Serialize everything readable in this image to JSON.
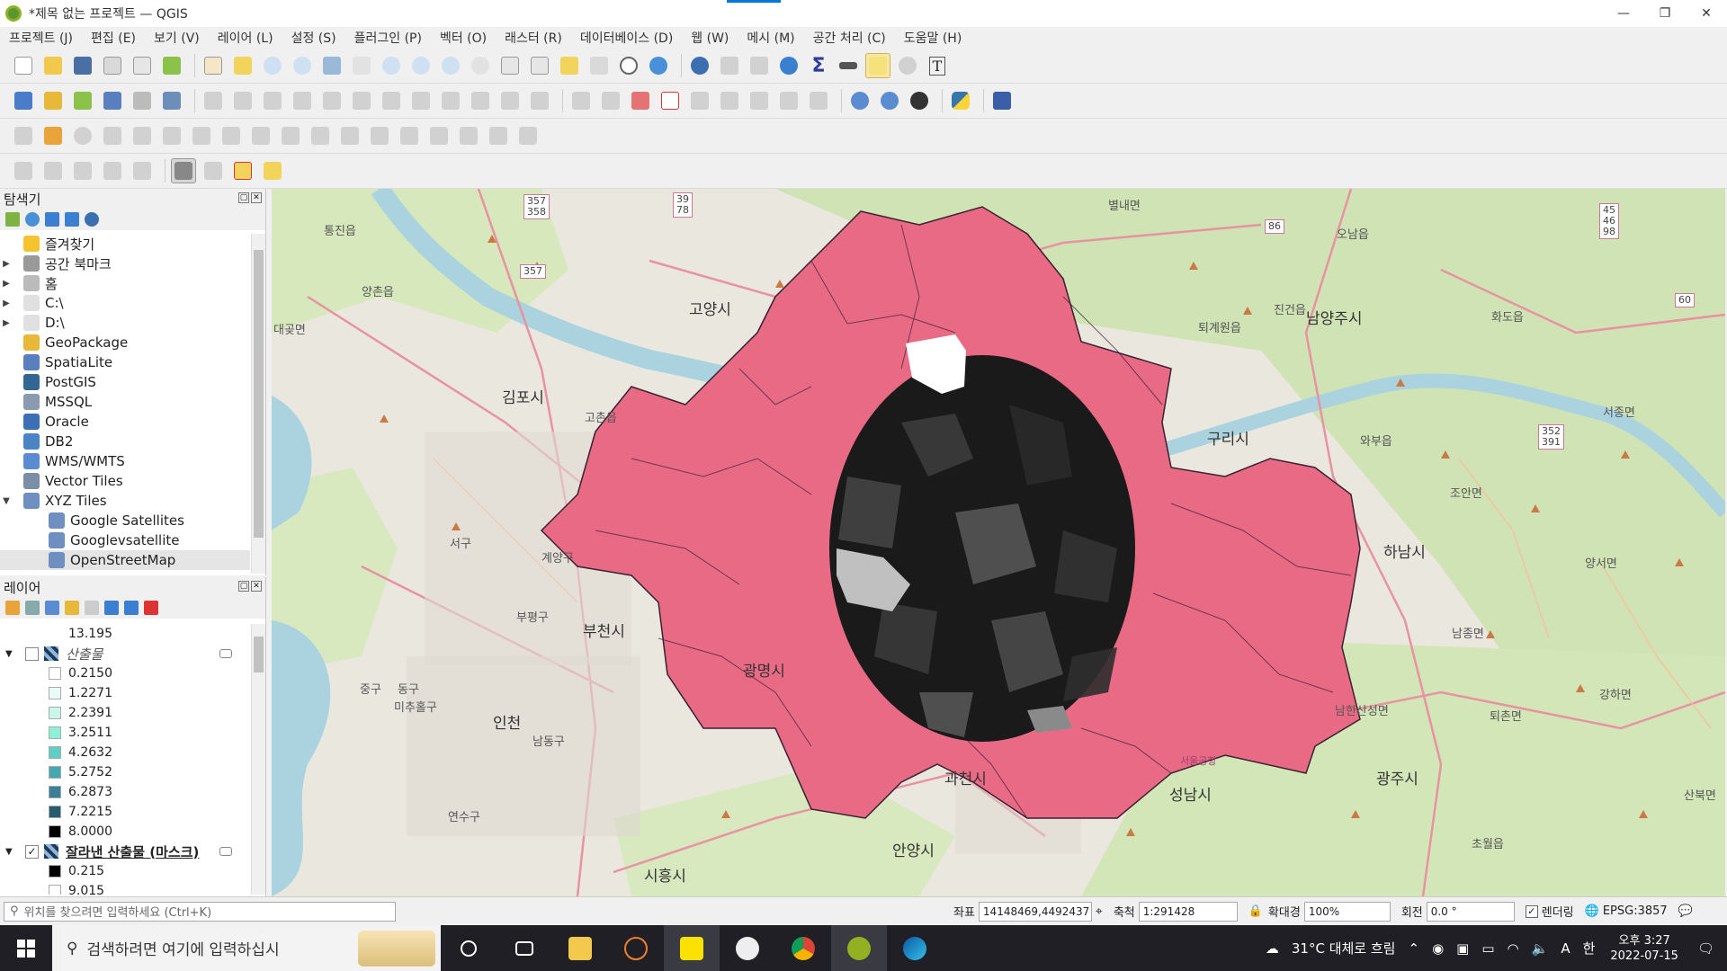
{
  "window": {
    "title": "*제목 없는 프로젝트 — QGIS",
    "minimize": "—",
    "restore": "❐",
    "close": "✕"
  },
  "menu": [
    "프로젝트 (J)",
    "편집 (E)",
    "보기 (V)",
    "레이어 (L)",
    "설정 (S)",
    "플러그인 (P)",
    "벡터 (O)",
    "래스터 (R)",
    "데이터베이스 (D)",
    "웹 (W)",
    "메시 (M)",
    "공간 처리 (C)",
    "도움말 (H)"
  ],
  "browser": {
    "title": "탐색기",
    "items": [
      {
        "label": "즐겨찾기",
        "icon": "star-icon",
        "arrow": "",
        "color": "#f4c430"
      },
      {
        "label": "공간 북마크",
        "icon": "bookmark-icon",
        "arrow": "▶",
        "color": "#999999"
      },
      {
        "label": "홈",
        "icon": "home-icon",
        "arrow": "▶",
        "color": "#bbbbbb"
      },
      {
        "label": "C:\\",
        "icon": "folder-icon",
        "arrow": "▶",
        "color": "#e0e0e0"
      },
      {
        "label": "D:\\",
        "icon": "folder-icon",
        "arrow": "▶",
        "color": "#e0e0e0"
      },
      {
        "label": "GeoPackage",
        "icon": "geopackage-icon",
        "arrow": "",
        "color": "#e8b83a"
      },
      {
        "label": "SpatiaLite",
        "icon": "spatialite-icon",
        "arrow": "",
        "color": "#5a7fbf"
      },
      {
        "label": "PostGIS",
        "icon": "postgis-icon",
        "arrow": "",
        "color": "#336791"
      },
      {
        "label": "MSSQL",
        "icon": "mssql-icon",
        "arrow": "",
        "color": "#8a9bb0"
      },
      {
        "label": "Oracle",
        "icon": "oracle-icon",
        "arrow": "",
        "color": "#3d6fb5"
      },
      {
        "label": "DB2",
        "icon": "db2-icon",
        "arrow": "",
        "color": "#4a84c4"
      },
      {
        "label": "WMS/WMTS",
        "icon": "globe-icon",
        "arrow": "",
        "color": "#5b8bd0"
      },
      {
        "label": "Vector Tiles",
        "icon": "grid-icon",
        "arrow": "",
        "color": "#7a8ea8"
      },
      {
        "label": "XYZ Tiles",
        "icon": "grid-icon",
        "arrow": "▼",
        "color": "#6f8fc0"
      },
      {
        "label": "Google Satellites",
        "icon": "grid-icon",
        "arrow": "",
        "sub": true,
        "color": "#6f8fc0"
      },
      {
        "label": "Googlevsatellite",
        "icon": "grid-icon",
        "arrow": "",
        "sub": true,
        "color": "#6f8fc0"
      },
      {
        "label": "OpenStreetMap",
        "icon": "grid-icon",
        "arrow": "",
        "sub": true,
        "selected": true,
        "color": "#6f8fc0"
      }
    ]
  },
  "layers": {
    "title": "레이어",
    "top_value": "13.195",
    "group1": {
      "name": "산출물",
      "checked": false,
      "entries": [
        {
          "label": "0.2150",
          "color": "#ffffff"
        },
        {
          "label": "1.2271",
          "color": "#e8fbf6"
        },
        {
          "label": "2.2391",
          "color": "#c8f7ea"
        },
        {
          "label": "3.2511",
          "color": "#8ef0d6"
        },
        {
          "label": "4.2632",
          "color": "#5fcfc4"
        },
        {
          "label": "5.2752",
          "color": "#45a8b0"
        },
        {
          "label": "6.2873",
          "color": "#3a7f97"
        },
        {
          "label": "7.2215",
          "color": "#285a6e"
        },
        {
          "label": "8.0000",
          "color": "#000000"
        }
      ]
    },
    "group2": {
      "name": "잘라낸 산출물 (마스크)",
      "checked": true,
      "entries": [
        {
          "label": "0.215",
          "color": "#000000"
        },
        {
          "label": "9.015",
          "color": "#ffffff"
        }
      ]
    }
  },
  "map": {
    "labels": {
      "cities": [
        "고양시",
        "김포시",
        "부천시",
        "인천",
        "남양주시",
        "구리시",
        "하남시",
        "성남시",
        "과천시",
        "안양시",
        "광명시",
        "시흥시",
        "광주시"
      ],
      "towns": [
        "통진읍",
        "양촌읍",
        "대곶면",
        "고촌읍",
        "서구",
        "계양구",
        "부평구",
        "중구",
        "동구",
        "미추홀구",
        "남동구",
        "연수구",
        "진건읍",
        "오남읍",
        "화도읍",
        "별내면",
        "퇴계원읍",
        "와부읍",
        "조안면",
        "서종면",
        "양서면",
        "남종면",
        "퇴촌면",
        "강하면",
        "남한산성면",
        "초월읍",
        "산북면",
        "서울공항"
      ],
      "shields": [
        "357\n358",
        "357",
        "39\n78",
        "86",
        "60",
        "45\n46\n98",
        "352\n391"
      ]
    },
    "colors": {
      "mask_fill": "#e86a85",
      "base": "#eae7df",
      "green": "#cfe3b4",
      "water": "#aad3df"
    }
  },
  "status": {
    "locator_placeholder": "위치를 찾으려면 입력하세요 (Ctrl+K)",
    "coord_label": "좌표",
    "coord_value": "14148469,4492437",
    "scale_label": "축척",
    "scale_value": "1:291428",
    "magnifier_label": "확대경",
    "magnifier_value": "100%",
    "rotation_label": "회전",
    "rotation_value": "0.0 °",
    "render_label": "렌더링",
    "crs": "EPSG:3857"
  },
  "taskbar": {
    "search_placeholder": "검색하려면 여기에 입력하십시",
    "weather": "31°C 대체로 흐림",
    "ime1": "A",
    "ime2": "한",
    "time": "오후 3:27",
    "date": "2022-07-15"
  }
}
